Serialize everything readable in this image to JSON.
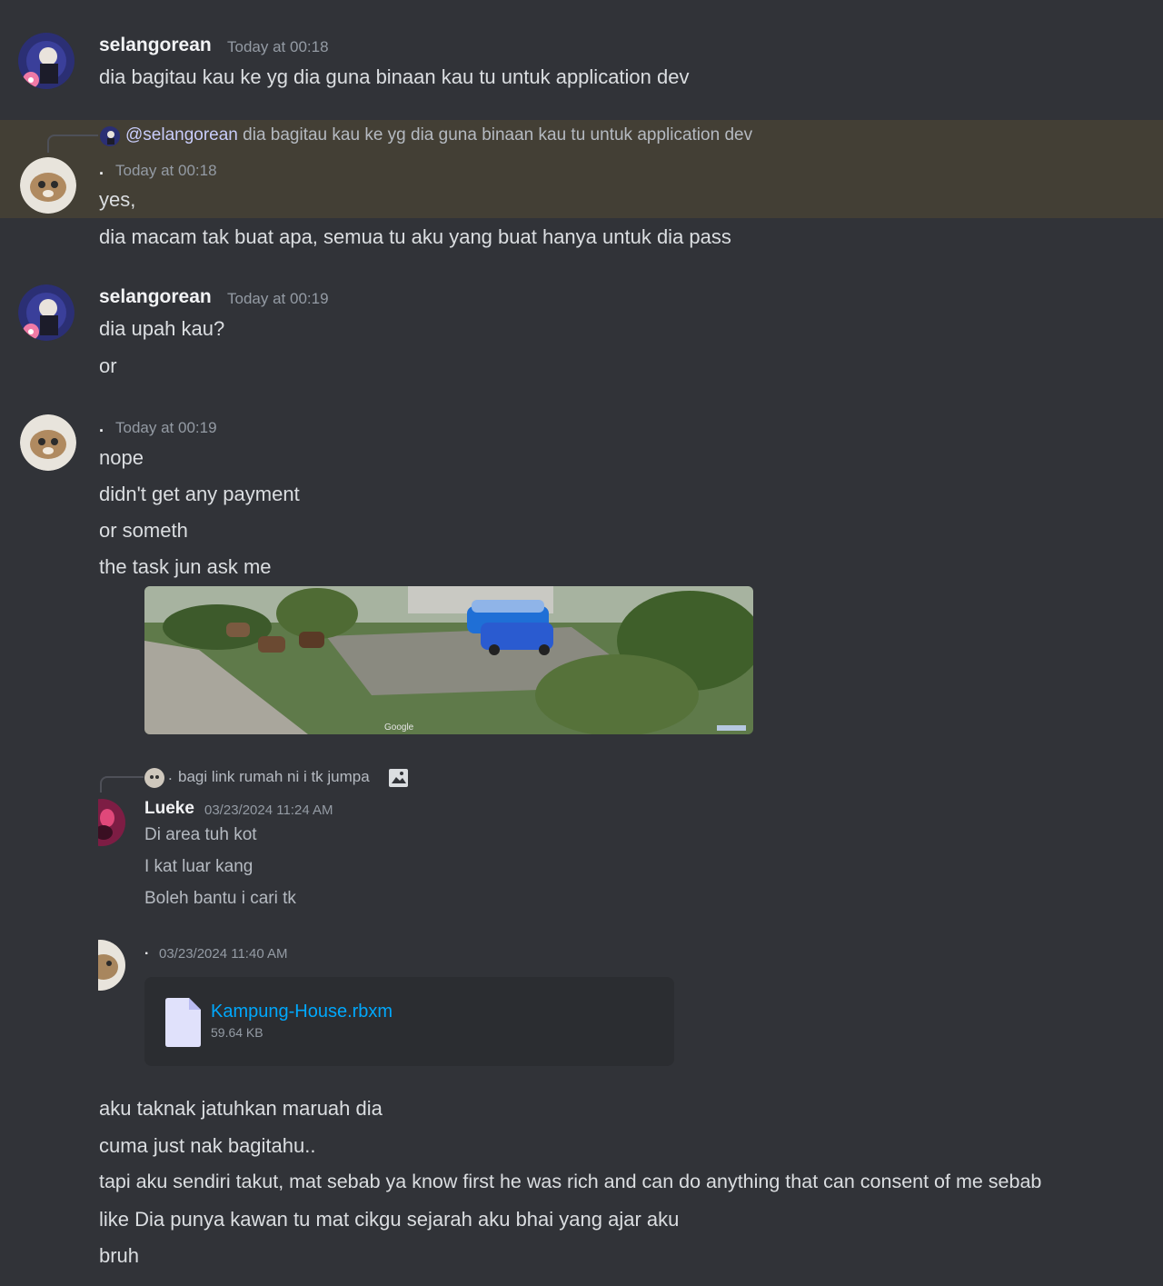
{
  "messages": {
    "m1": {
      "author": "selangorean",
      "time": "Today at 00:18",
      "lines": [
        "dia bagitau kau ke yg dia guna binaan kau tu untuk application dev"
      ]
    },
    "m2": {
      "reply": {
        "mention": "@selangorean",
        "text": "dia bagitau kau ke yg dia guna binaan kau tu untuk application dev"
      },
      "author": ".",
      "time": "Today at 00:18",
      "lines": [
        "yes,",
        "dia macam tak buat apa, semua tu aku yang buat hanya untuk dia pass"
      ]
    },
    "m3": {
      "author": "selangorean",
      "time": "Today at 00:19",
      "lines": [
        "dia upah kau?",
        "or"
      ]
    },
    "m4": {
      "author": ".",
      "time": "Today at 00:19",
      "lines": [
        "nope",
        "didn't get any payment",
        "or someth",
        "the task jun ask me"
      ]
    },
    "m5": {
      "lines": [
        "aku taknak jatuhkan maruah dia",
        "cuma just nak bagitahu..",
        "tapi aku sendiri takut, mat sebab ya know first he was rich and can do anything that can consent of me sebab",
        "like Dia punya kawan tu mat cikgu sejarah aku bhai yang ajar aku",
        "bruh"
      ]
    }
  },
  "embed": {
    "reply": {
      "author": ".",
      "text": "bagi link rumah ni i tk jumpa"
    },
    "lueke": {
      "author": "Lueke",
      "time": "03/23/2024 11:24 AM",
      "lines": [
        "Di area tuh kot",
        "I kat luar kang",
        "Boleh bantu i cari tk"
      ]
    },
    "dot": {
      "author": ".",
      "time": "03/23/2024 11:40 AM"
    },
    "file": {
      "name": "Kampung-House.rbxm",
      "size": "59.64 KB"
    },
    "image_watermark": "Google"
  },
  "colors": {
    "background": "#313338",
    "highlight": "#433f35",
    "link": "#00a8fc",
    "timestamp": "#949ba4"
  }
}
